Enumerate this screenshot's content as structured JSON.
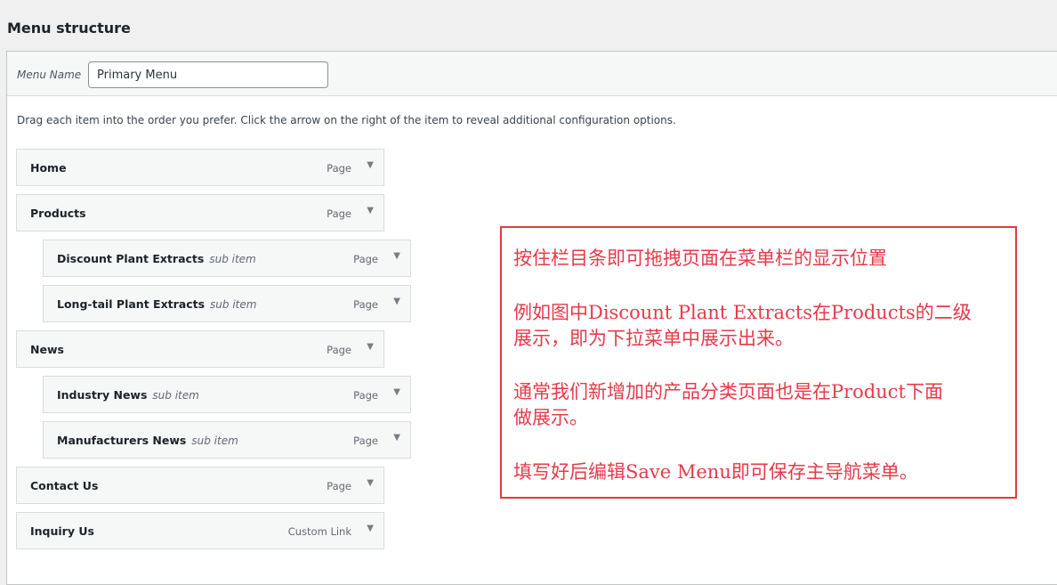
{
  "page_title": "Menu structure",
  "menu_name": {
    "label": "Menu Name",
    "value": "Primary Menu"
  },
  "instructions": "Drag each item into the order you prefer. Click the arrow on the right of the item to reveal additional configuration options.",
  "items": [
    {
      "title": "Home",
      "sub": "",
      "type": "Page",
      "level": 0
    },
    {
      "title": "Products",
      "sub": "",
      "type": "Page",
      "level": 0
    },
    {
      "title": "Discount Plant Extracts",
      "sub": "sub item",
      "type": "Page",
      "level": 1
    },
    {
      "title": "Long-tail Plant Extracts",
      "sub": "sub item",
      "type": "Page",
      "level": 1
    },
    {
      "title": "News",
      "sub": "",
      "type": "Page",
      "level": 0
    },
    {
      "title": "Industry News",
      "sub": "sub item",
      "type": "Page",
      "level": 1
    },
    {
      "title": "Manufacturers News",
      "sub": "sub item",
      "type": "Page",
      "level": 1
    },
    {
      "title": "Contact Us",
      "sub": "",
      "type": "Page",
      "level": 0
    },
    {
      "title": "Inquiry Us",
      "sub": "",
      "type": "Custom Link",
      "level": 0
    }
  ],
  "arrow_icon": "triangle-down-icon",
  "annotation": {
    "color": "#e8394a",
    "p1": "按住栏目条即可拖拽页面在菜单栏的显示位置",
    "p2a": "例如图中Discount Plant Extracts在Products的二级",
    "p2b": "展示，即为下拉菜单中展示出来。",
    "p3a": "通常我们新增加的产品分类页面也是在Product下面",
    "p3b": "做展示。",
    "p4": "填写好后编辑Save Menu即可保存主导航菜单。"
  }
}
